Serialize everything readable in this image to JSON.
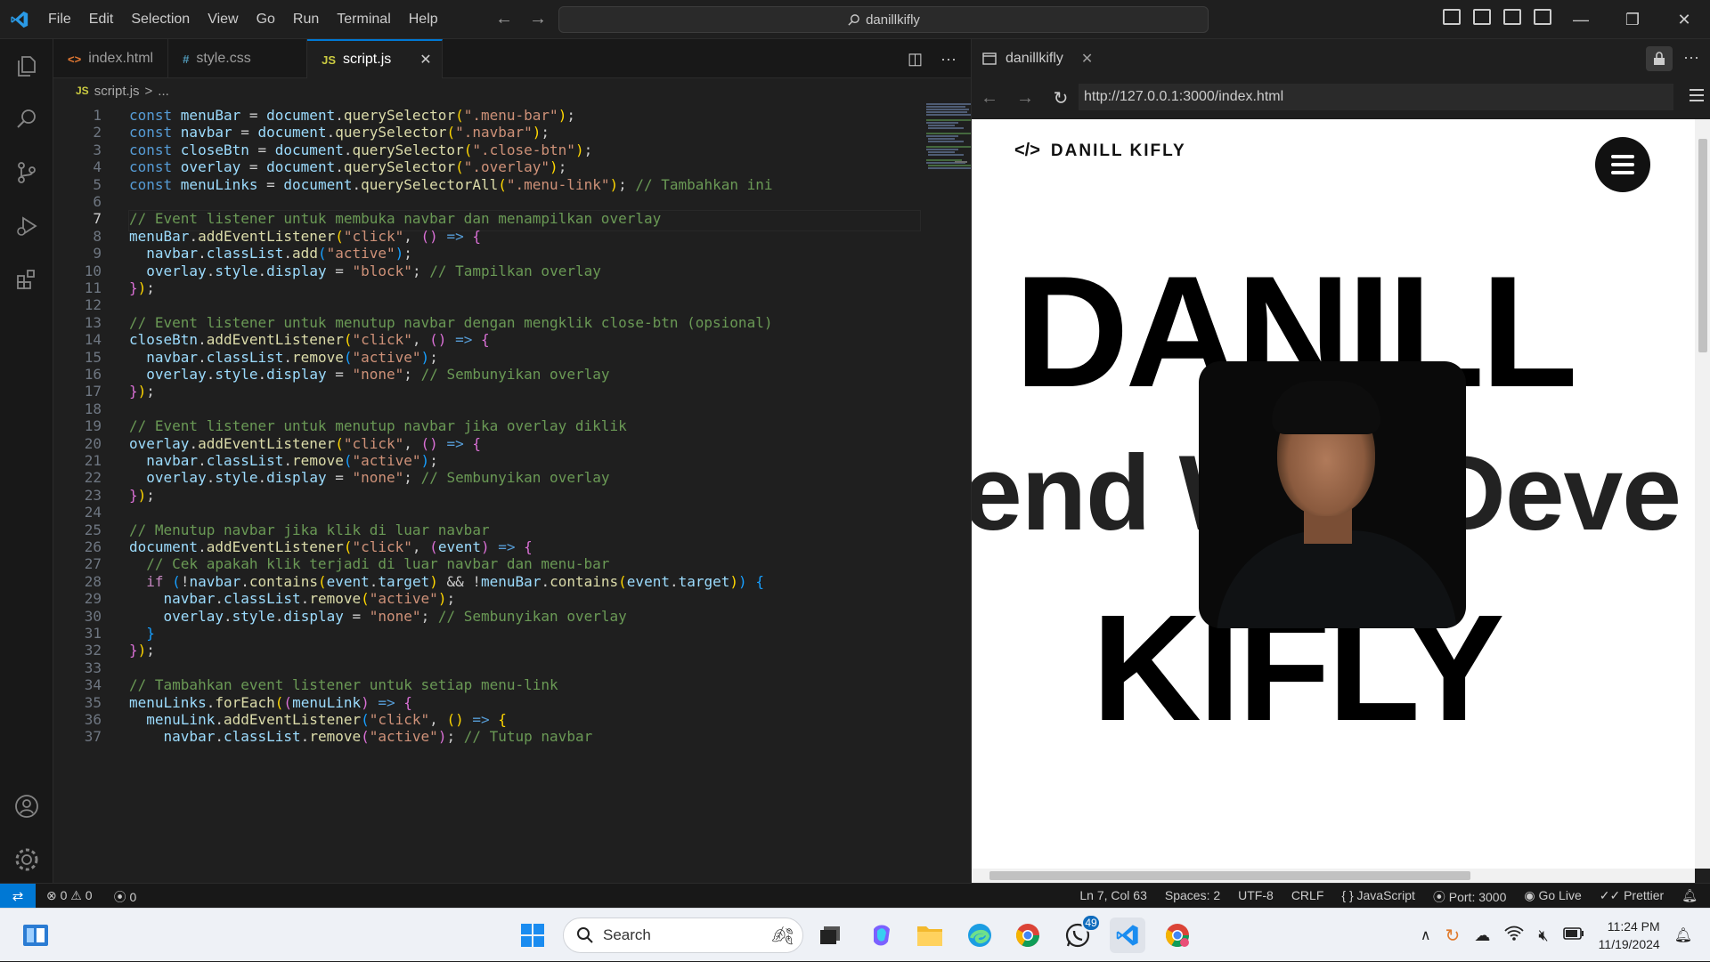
{
  "titlebar": {
    "menu": [
      "File",
      "Edit",
      "Selection",
      "View",
      "Go",
      "Run",
      "Terminal",
      "Help"
    ],
    "search": "danillkifly"
  },
  "tabs": [
    {
      "icon": "<>",
      "label": "index.html",
      "active": false
    },
    {
      "icon": "#",
      "label": "style.css",
      "active": false
    },
    {
      "icon": "JS",
      "label": "script.js",
      "active": true
    }
  ],
  "breadcrumb": {
    "icon": "JS",
    "file": "script.js",
    "sep": ">",
    "rest": "..."
  },
  "editor": {
    "current_line": 7,
    "lines": [
      [
        [
          "k",
          "const "
        ],
        [
          "v",
          "menuBar"
        ],
        [
          "p",
          " = "
        ],
        [
          "v",
          "document"
        ],
        [
          "p",
          "."
        ],
        [
          "f",
          "querySelector"
        ],
        [
          "br1",
          "("
        ],
        [
          "s",
          "\".menu-bar\""
        ],
        [
          "br1",
          ")"
        ],
        [
          "p",
          ";"
        ]
      ],
      [
        [
          "k",
          "const "
        ],
        [
          "v",
          "navbar"
        ],
        [
          "p",
          " = "
        ],
        [
          "v",
          "document"
        ],
        [
          "p",
          "."
        ],
        [
          "f",
          "querySelector"
        ],
        [
          "br1",
          "("
        ],
        [
          "s",
          "\".navbar\""
        ],
        [
          "br1",
          ")"
        ],
        [
          "p",
          ";"
        ]
      ],
      [
        [
          "k",
          "const "
        ],
        [
          "v",
          "closeBtn"
        ],
        [
          "p",
          " = "
        ],
        [
          "v",
          "document"
        ],
        [
          "p",
          "."
        ],
        [
          "f",
          "querySelector"
        ],
        [
          "br1",
          "("
        ],
        [
          "s",
          "\".close-btn\""
        ],
        [
          "br1",
          ")"
        ],
        [
          "p",
          ";"
        ]
      ],
      [
        [
          "k",
          "const "
        ],
        [
          "v",
          "overlay"
        ],
        [
          "p",
          " = "
        ],
        [
          "v",
          "document"
        ],
        [
          "p",
          "."
        ],
        [
          "f",
          "querySelector"
        ],
        [
          "br1",
          "("
        ],
        [
          "s",
          "\".overlay\""
        ],
        [
          "br1",
          ")"
        ],
        [
          "p",
          ";"
        ]
      ],
      [
        [
          "k",
          "const "
        ],
        [
          "v",
          "menuLinks"
        ],
        [
          "p",
          " = "
        ],
        [
          "v",
          "document"
        ],
        [
          "p",
          "."
        ],
        [
          "f",
          "querySelectorAll"
        ],
        [
          "br1",
          "("
        ],
        [
          "s",
          "\".menu-link\""
        ],
        [
          "br1",
          ")"
        ],
        [
          "p",
          "; "
        ],
        [
          "c",
          "// Tambahkan ini"
        ]
      ],
      [],
      [
        [
          "c",
          "// Event listener untuk membuka navbar dan menampilkan overlay"
        ]
      ],
      [
        [
          "v",
          "menuBar"
        ],
        [
          "p",
          "."
        ],
        [
          "f",
          "addEventListener"
        ],
        [
          "br1",
          "("
        ],
        [
          "s",
          "\"click\""
        ],
        [
          "p",
          ", "
        ],
        [
          "br2",
          "()"
        ],
        [
          "k",
          " => "
        ],
        [
          "br2",
          "{"
        ]
      ],
      [
        [
          "p",
          "  "
        ],
        [
          "v",
          "navbar"
        ],
        [
          "p",
          "."
        ],
        [
          "v",
          "classList"
        ],
        [
          "p",
          "."
        ],
        [
          "f",
          "add"
        ],
        [
          "br3",
          "("
        ],
        [
          "s",
          "\"active\""
        ],
        [
          "br3",
          ")"
        ],
        [
          "p",
          ";"
        ]
      ],
      [
        [
          "p",
          "  "
        ],
        [
          "v",
          "overlay"
        ],
        [
          "p",
          "."
        ],
        [
          "v",
          "style"
        ],
        [
          "p",
          "."
        ],
        [
          "v",
          "display"
        ],
        [
          "p",
          " = "
        ],
        [
          "s",
          "\"block\""
        ],
        [
          "p",
          "; "
        ],
        [
          "c",
          "// Tampilkan overlay"
        ]
      ],
      [
        [
          "br2",
          "}"
        ],
        [
          "br1",
          ")"
        ],
        [
          "p",
          ";"
        ]
      ],
      [],
      [
        [
          "c",
          "// Event listener untuk menutup navbar dengan mengklik close-btn (opsional)"
        ]
      ],
      [
        [
          "v",
          "closeBtn"
        ],
        [
          "p",
          "."
        ],
        [
          "f",
          "addEventListener"
        ],
        [
          "br1",
          "("
        ],
        [
          "s",
          "\"click\""
        ],
        [
          "p",
          ", "
        ],
        [
          "br2",
          "()"
        ],
        [
          "k",
          " => "
        ],
        [
          "br2",
          "{"
        ]
      ],
      [
        [
          "p",
          "  "
        ],
        [
          "v",
          "navbar"
        ],
        [
          "p",
          "."
        ],
        [
          "v",
          "classList"
        ],
        [
          "p",
          "."
        ],
        [
          "f",
          "remove"
        ],
        [
          "br3",
          "("
        ],
        [
          "s",
          "\"active\""
        ],
        [
          "br3",
          ")"
        ],
        [
          "p",
          ";"
        ]
      ],
      [
        [
          "p",
          "  "
        ],
        [
          "v",
          "overlay"
        ],
        [
          "p",
          "."
        ],
        [
          "v",
          "style"
        ],
        [
          "p",
          "."
        ],
        [
          "v",
          "display"
        ],
        [
          "p",
          " = "
        ],
        [
          "s",
          "\"none\""
        ],
        [
          "p",
          "; "
        ],
        [
          "c",
          "// Sembunyikan overlay"
        ]
      ],
      [
        [
          "br2",
          "}"
        ],
        [
          "br1",
          ")"
        ],
        [
          "p",
          ";"
        ]
      ],
      [],
      [
        [
          "c",
          "// Event listener untuk menutup navbar jika overlay diklik"
        ]
      ],
      [
        [
          "v",
          "overlay"
        ],
        [
          "p",
          "."
        ],
        [
          "f",
          "addEventListener"
        ],
        [
          "br1",
          "("
        ],
        [
          "s",
          "\"click\""
        ],
        [
          "p",
          ", "
        ],
        [
          "br2",
          "()"
        ],
        [
          "k",
          " => "
        ],
        [
          "br2",
          "{"
        ]
      ],
      [
        [
          "p",
          "  "
        ],
        [
          "v",
          "navbar"
        ],
        [
          "p",
          "."
        ],
        [
          "v",
          "classList"
        ],
        [
          "p",
          "."
        ],
        [
          "f",
          "remove"
        ],
        [
          "br3",
          "("
        ],
        [
          "s",
          "\"active\""
        ],
        [
          "br3",
          ")"
        ],
        [
          "p",
          ";"
        ]
      ],
      [
        [
          "p",
          "  "
        ],
        [
          "v",
          "overlay"
        ],
        [
          "p",
          "."
        ],
        [
          "v",
          "style"
        ],
        [
          "p",
          "."
        ],
        [
          "v",
          "display"
        ],
        [
          "p",
          " = "
        ],
        [
          "s",
          "\"none\""
        ],
        [
          "p",
          "; "
        ],
        [
          "c",
          "// Sembunyikan overlay"
        ]
      ],
      [
        [
          "br2",
          "}"
        ],
        [
          "br1",
          ")"
        ],
        [
          "p",
          ";"
        ]
      ],
      [],
      [
        [
          "c",
          "// Menutup navbar jika klik di luar navbar"
        ]
      ],
      [
        [
          "v",
          "document"
        ],
        [
          "p",
          "."
        ],
        [
          "f",
          "addEventListener"
        ],
        [
          "br1",
          "("
        ],
        [
          "s",
          "\"click\""
        ],
        [
          "p",
          ", "
        ],
        [
          "br2",
          "("
        ],
        [
          "v",
          "event"
        ],
        [
          "br2",
          ")"
        ],
        [
          "k",
          " => "
        ],
        [
          "br2",
          "{"
        ]
      ],
      [
        [
          "p",
          "  "
        ],
        [
          "c",
          "// Cek apakah klik terjadi di luar navbar dan menu-bar"
        ]
      ],
      [
        [
          "p",
          "  "
        ],
        [
          "ctl",
          "if "
        ],
        [
          "br3",
          "("
        ],
        [
          "p",
          "!"
        ],
        [
          "v",
          "navbar"
        ],
        [
          "p",
          "."
        ],
        [
          "f",
          "contains"
        ],
        [
          "br1",
          "("
        ],
        [
          "v",
          "event"
        ],
        [
          "p",
          "."
        ],
        [
          "v",
          "target"
        ],
        [
          "br1",
          ")"
        ],
        [
          "p",
          " && !"
        ],
        [
          "v",
          "menuBar"
        ],
        [
          "p",
          "."
        ],
        [
          "f",
          "contains"
        ],
        [
          "br1",
          "("
        ],
        [
          "v",
          "event"
        ],
        [
          "p",
          "."
        ],
        [
          "v",
          "target"
        ],
        [
          "br1",
          ")"
        ],
        [
          "br3",
          ")"
        ],
        [
          "p",
          " "
        ],
        [
          "br3",
          "{"
        ]
      ],
      [
        [
          "p",
          "    "
        ],
        [
          "v",
          "navbar"
        ],
        [
          "p",
          "."
        ],
        [
          "v",
          "classList"
        ],
        [
          "p",
          "."
        ],
        [
          "f",
          "remove"
        ],
        [
          "br1",
          "("
        ],
        [
          "s",
          "\"active\""
        ],
        [
          "br1",
          ")"
        ],
        [
          "p",
          ";"
        ]
      ],
      [
        [
          "p",
          "    "
        ],
        [
          "v",
          "overlay"
        ],
        [
          "p",
          "."
        ],
        [
          "v",
          "style"
        ],
        [
          "p",
          "."
        ],
        [
          "v",
          "display"
        ],
        [
          "p",
          " = "
        ],
        [
          "s",
          "\"none\""
        ],
        [
          "p",
          "; "
        ],
        [
          "c",
          "// Sembunyikan overlay"
        ]
      ],
      [
        [
          "p",
          "  "
        ],
        [
          "br3",
          "}"
        ]
      ],
      [
        [
          "br2",
          "}"
        ],
        [
          "br1",
          ")"
        ],
        [
          "p",
          ";"
        ]
      ],
      [],
      [
        [
          "c",
          "// Tambahkan event listener untuk setiap menu-link"
        ]
      ],
      [
        [
          "v",
          "menuLinks"
        ],
        [
          "p",
          "."
        ],
        [
          "f",
          "forEach"
        ],
        [
          "br1",
          "("
        ],
        [
          "br2",
          "("
        ],
        [
          "v",
          "menuLink"
        ],
        [
          "br2",
          ")"
        ],
        [
          "k",
          " => "
        ],
        [
          "br2",
          "{"
        ]
      ],
      [
        [
          "p",
          "  "
        ],
        [
          "v",
          "menuLink"
        ],
        [
          "p",
          "."
        ],
        [
          "f",
          "addEventListener"
        ],
        [
          "br3",
          "("
        ],
        [
          "s",
          "\"click\""
        ],
        [
          "p",
          ", "
        ],
        [
          "br1",
          "()"
        ],
        [
          "k",
          " => "
        ],
        [
          "br1",
          "{"
        ]
      ],
      [
        [
          "p",
          "    "
        ],
        [
          "v",
          "navbar"
        ],
        [
          "p",
          "."
        ],
        [
          "v",
          "classList"
        ],
        [
          "p",
          "."
        ],
        [
          "f",
          "remove"
        ],
        [
          "br2",
          "("
        ],
        [
          "s",
          "\"active\""
        ],
        [
          "br2",
          ")"
        ],
        [
          "p",
          "; "
        ],
        [
          "c",
          "// Tutup navbar"
        ]
      ]
    ]
  },
  "browser": {
    "tab_label": "danillkifly",
    "url": "http://127.0.0.1:3000/index.html",
    "page": {
      "brand_icon": "</>",
      "brand": "DANILL KIFLY",
      "line1": "DANILL",
      "line2": "end Web Deve",
      "line3": "KIFLY"
    }
  },
  "statusbar": {
    "errors": "0",
    "warnings": "0",
    "ports": "0",
    "position": "Ln 7, Col 63",
    "spaces": "Spaces: 2",
    "encoding": "UTF-8",
    "eol": "CRLF",
    "language": "JavaScript",
    "port": "Port: 3000",
    "golive": "Go Live",
    "prettier": "Prettier"
  },
  "taskbar": {
    "search_placeholder": "Search",
    "whatsapp_badge": "49",
    "time": "11:24 PM",
    "date": "11/19/2024"
  },
  "colors": {
    "accent": "#0078d4",
    "editor_bg": "#1f1f1f",
    "keyword": "#569cd6",
    "string": "#ce9178",
    "comment": "#6a9955",
    "function": "#dcdcaa",
    "variable": "#9cdcfe"
  }
}
